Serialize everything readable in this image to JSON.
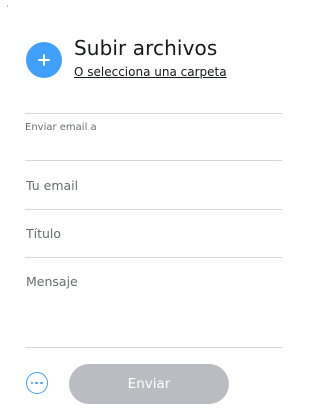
{
  "upload": {
    "title": "Subir archivos",
    "folder_link": "O selecciona una carpeta",
    "add_icon": "plus-icon"
  },
  "form": {
    "recipient_label": "Enviar email a",
    "recipient_value": "",
    "email_placeholder": "Tu email",
    "title_placeholder": "Título",
    "message_placeholder": "Mensaje"
  },
  "footer": {
    "more_icon": "ellipsis-icon",
    "send_label": "Enviar",
    "send_enabled": false
  },
  "colors": {
    "accent": "#409fff",
    "disabled_button": "#b9bcc0",
    "divider": "#d4d7d9",
    "text": "#17181a",
    "placeholder": "#6a6d70"
  }
}
